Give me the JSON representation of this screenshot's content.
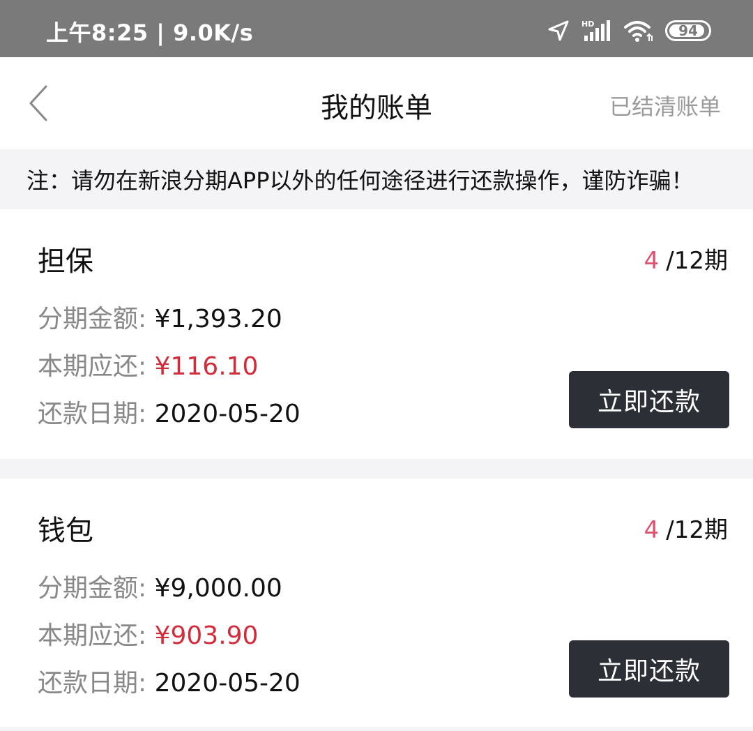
{
  "status_bar": {
    "time": "上午8:25 | 9.0K/s",
    "battery": "94",
    "battery_level": 0.94,
    "icons": [
      "location-arrow-icon",
      "hd-signal-icon",
      "wifi-icon",
      "battery-icon"
    ]
  },
  "nav": {
    "back_icon": "chevron-left-icon",
    "title": "我的账单",
    "right_link": "已结清账单"
  },
  "notice": "注：请勿在新浪分期APP以外的任何途径进行还款操作，谨防诈骗！",
  "bills": [
    {
      "title": "担保",
      "period_current": "4",
      "period_total": "/12期",
      "amount_label": "分期金额:",
      "amount_value": "¥1,393.20",
      "due_label": "本期应还:",
      "due_value": "¥116.10",
      "date_label": "还款日期:",
      "date_value": "2020-05-20",
      "pay_button": "立即还款"
    },
    {
      "title": "钱包",
      "period_current": "4",
      "period_total": "/12期",
      "amount_label": "分期金额:",
      "amount_value": "¥9,000.00",
      "due_label": "本期应还:",
      "due_value": "¥903.90",
      "date_label": "还款日期:",
      "date_value": "2020-05-20",
      "pay_button": "立即还款"
    }
  ],
  "colors": {
    "status_bar": "#7a7a7a",
    "accent_red": "#d42b3a",
    "period_pink": "#e05070",
    "button_dark": "#2c2f36"
  }
}
